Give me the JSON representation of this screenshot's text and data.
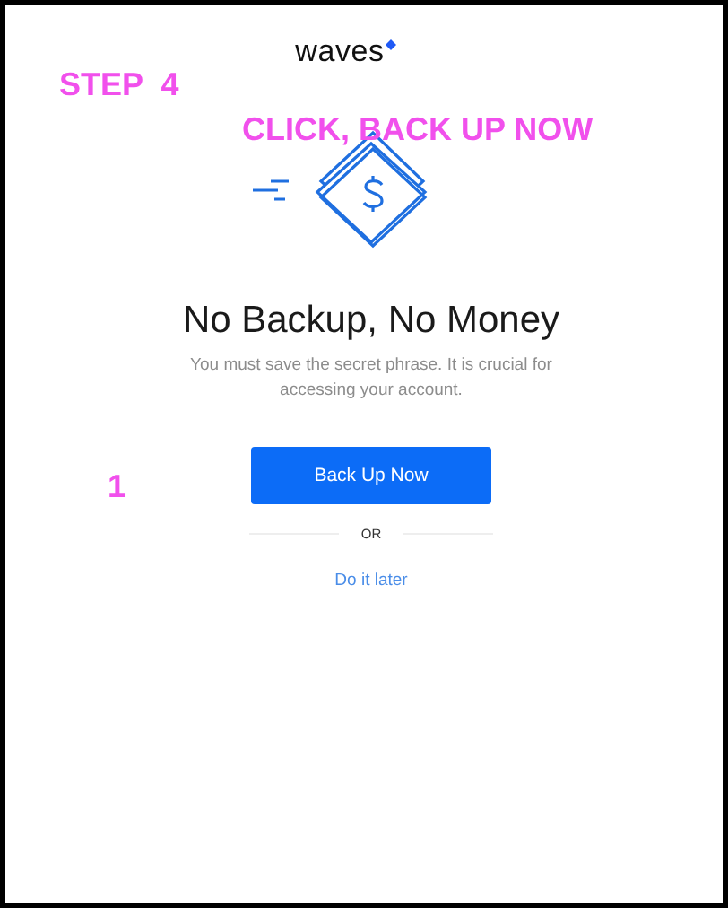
{
  "logo": {
    "text": "waves"
  },
  "annotations": [
    {
      "kind": "step",
      "text": "STEP  4"
    },
    {
      "kind": "instruction",
      "text": "CLICK, BACK UP NOW"
    },
    {
      "kind": "marker",
      "text": "1"
    }
  ],
  "title": "No Backup, No Money",
  "message": "You must save the secret phrase. It is crucial for accessing your account.",
  "primary_button": "Back Up Now",
  "divider_text": "OR",
  "secondary_link": "Do it later"
}
